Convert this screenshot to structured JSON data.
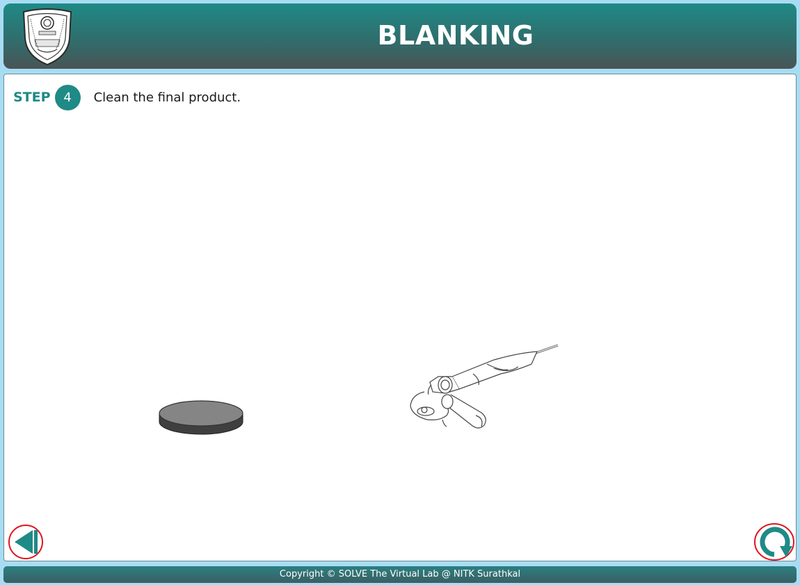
{
  "header": {
    "title": "BLANKING"
  },
  "step": {
    "label": "STEP",
    "number": "4",
    "instruction": "Clean the final product."
  },
  "controls": {
    "back_icon": "back-arrow-icon",
    "reset_icon": "reset-icon",
    "accent_color": "#1f8a86",
    "highlight_ring_color": "#e0141e"
  },
  "footer": {
    "copyright": "Copyright © SOLVE The Virtual Lab @ NITK Surathkal"
  }
}
